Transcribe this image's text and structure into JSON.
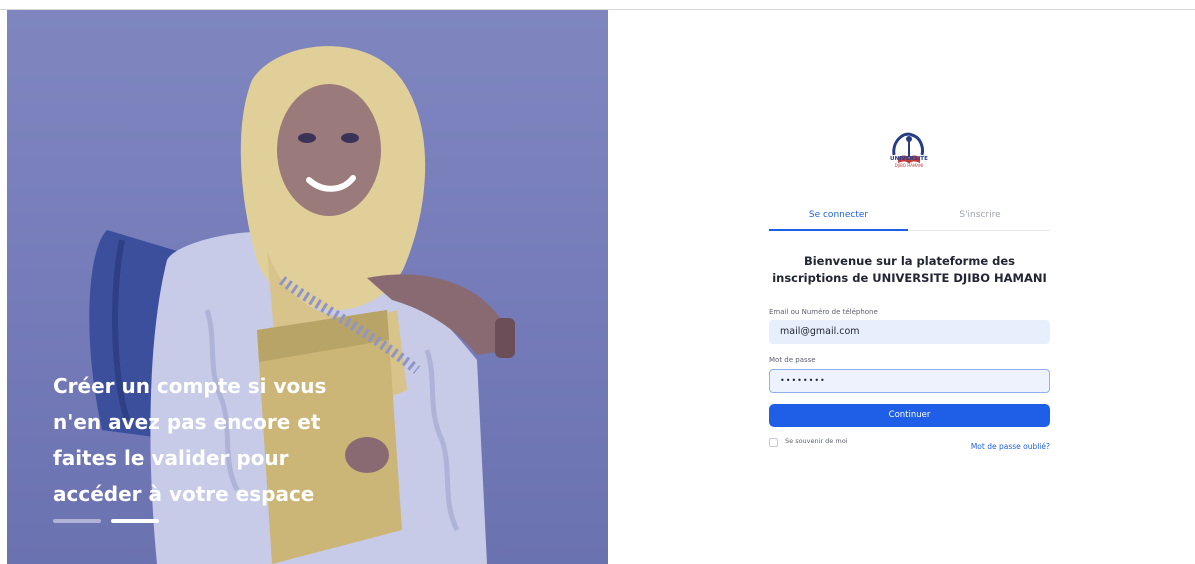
{
  "hero": {
    "caption_lines": [
      "Créer un compte si vous",
      "n'en avez pas encore et",
      "faites le valider pour",
      "accéder à votre espace"
    ],
    "slides_total": 2,
    "active_slide": 2
  },
  "brand": {
    "logo_text": "UNIVERSITE",
    "logo_subtext": "DJIBO HAMANI"
  },
  "tabs": {
    "login": "Se connecter",
    "register": "S'inscrire"
  },
  "welcome": {
    "line1": "Bienvenue sur la plateforme des",
    "line2": "inscriptions de UNIVERSITE DJIBO HAMANI"
  },
  "form": {
    "email_label": "Email ou Numéro de téléphone",
    "email_value": "mail@gmail.com",
    "password_label": "Mot de passe",
    "password_value": "••••••••",
    "submit_label": "Continuer",
    "remember_label": "Se souvenir de moi",
    "forgot_label": "Mot de passe oublié?"
  },
  "colors": {
    "accent": "#1f5fe8",
    "hero_overlay": "#767dba",
    "input_bg": "#e8effc"
  }
}
